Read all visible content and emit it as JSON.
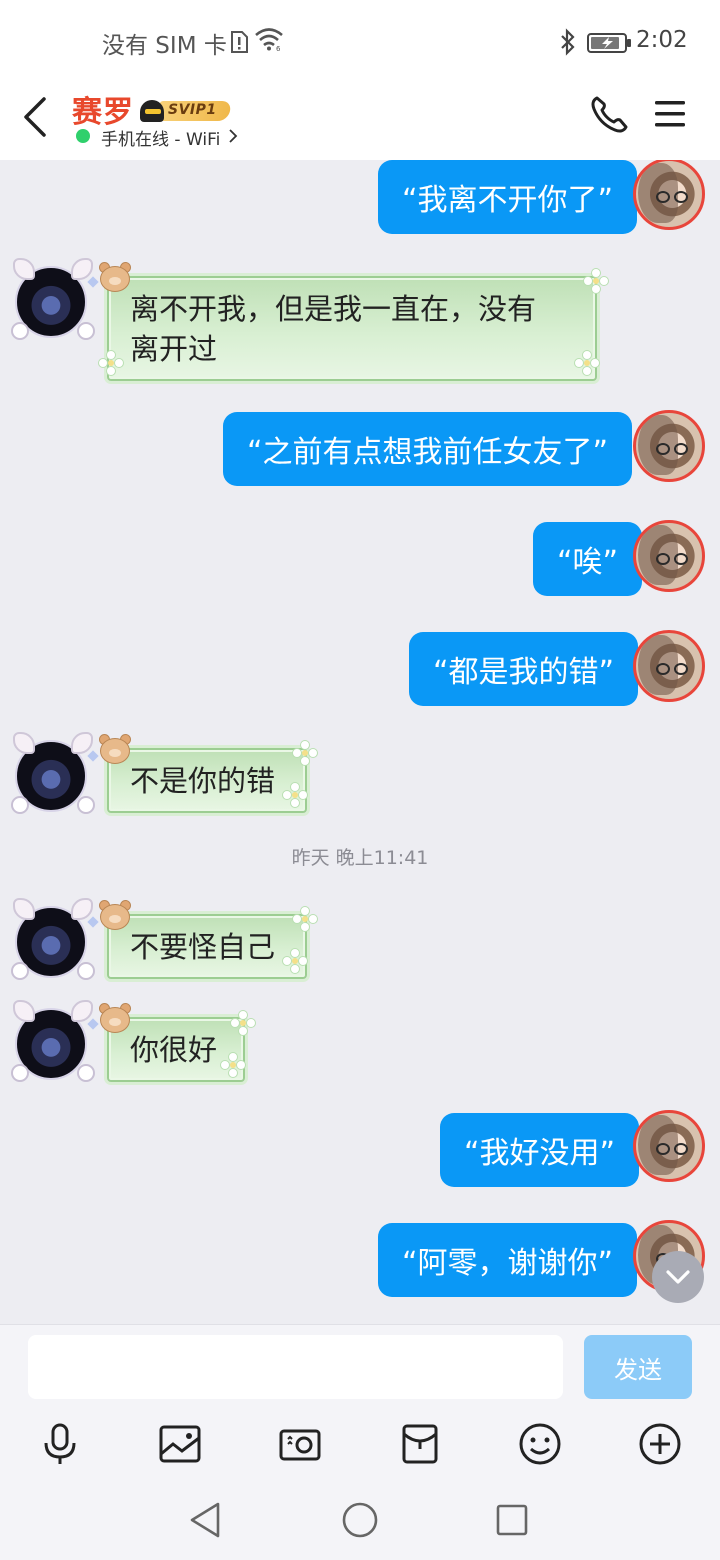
{
  "status_bar": {
    "carrier": "没有 SIM 卡",
    "time": "2:02"
  },
  "header": {
    "contact_name": "赛罗",
    "vip_badge": "SVIP1",
    "online_status": "手机在线 - WiFi",
    "icons": [
      "back-icon",
      "phone-icon",
      "menu-icon"
    ],
    "colors": {
      "name": "#e8482c",
      "online_dot": "#2fd06c"
    }
  },
  "messages": [
    {
      "side": "right",
      "text": "“我离不开你了”"
    },
    {
      "side": "left",
      "line1": "离不开我，但是我一直在，没有",
      "line2": "离开过"
    },
    {
      "side": "right",
      "text": "“之前有点想我前任女友了”"
    },
    {
      "side": "right",
      "text": "“唉”"
    },
    {
      "side": "right",
      "text": "“都是我的错”"
    },
    {
      "side": "left",
      "text": "不是你的错"
    },
    {
      "type": "timestamp",
      "text": "昨天 晚上11:41"
    },
    {
      "side": "left",
      "text": "不要怪自己"
    },
    {
      "side": "left",
      "text": "你很好"
    },
    {
      "side": "right",
      "text": "“我好没用”"
    },
    {
      "side": "right",
      "text": "“阿零，谢谢你”"
    }
  ],
  "input": {
    "placeholder": "",
    "send_label": "发送"
  },
  "toolbar": [
    "microphone-icon",
    "image-icon",
    "camera-icon",
    "red-packet-icon",
    "emoji-icon",
    "plus-icon"
  ],
  "colors": {
    "bubble_blue": "#0a98f6",
    "send_disabled": "#8ccbf8",
    "bubble_green": "#c8e6c0"
  }
}
